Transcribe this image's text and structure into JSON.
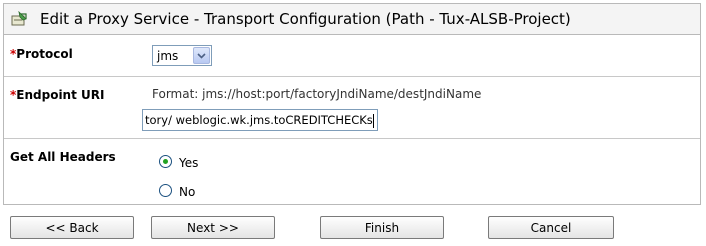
{
  "header": {
    "title": "Edit a Proxy Service - Transport Configuration (Path - Tux-ALSB-Project)"
  },
  "protocol": {
    "required_marker": "*",
    "label": "Protocol",
    "selected": "jms"
  },
  "endpoint": {
    "required_marker": "*",
    "label": "Endpoint URI",
    "format_hint": "Format: jms://host:port/factoryJndiName/destJndiName",
    "value": "tory/ weblogic.wk.jms.toCREDITCHECKs"
  },
  "headers": {
    "label": "Get All Headers",
    "options": [
      {
        "label": "Yes",
        "checked": true
      },
      {
        "label": "No",
        "checked": false
      }
    ]
  },
  "buttons": {
    "back": "<< Back",
    "next": "Next >>",
    "finish": "Finish",
    "cancel": "Cancel"
  }
}
